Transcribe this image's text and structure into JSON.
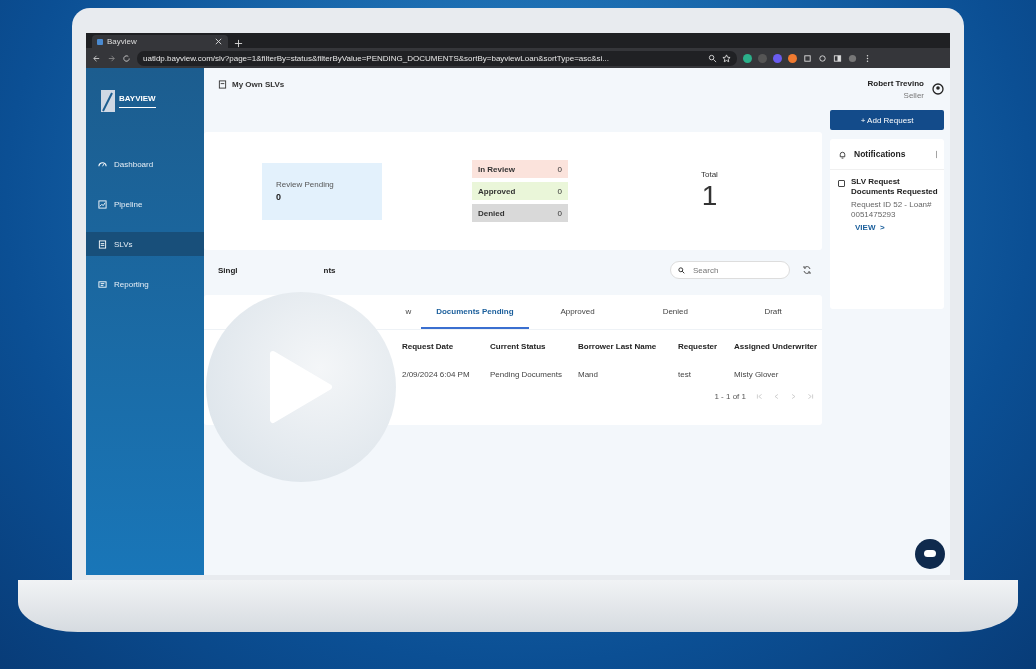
{
  "browser": {
    "tab_title": "Bayview",
    "address": "uatldp.bayview.com/slv?page=1&filterBy=status&filterByValue=PENDING_DOCUMENTS&sortBy=bayviewLoan&sortType=asc&si..."
  },
  "sidebar": {
    "logo": "BAYVIEW",
    "items": [
      {
        "label": "Dashboard",
        "selected": false
      },
      {
        "label": "Pipeline",
        "selected": false
      },
      {
        "label": "SLVs",
        "selected": true
      },
      {
        "label": "Reporting",
        "selected": false
      }
    ]
  },
  "header": {
    "title": "My Own SLVs",
    "user_name": "Robert Trevino",
    "user_role": "Seller"
  },
  "stats": {
    "review_pending_label": "Review Pending",
    "review_pending_value": "0",
    "statuses": [
      {
        "label": "In Review",
        "count": "0",
        "color": "#fbe3dc"
      },
      {
        "label": "Approved",
        "count": "0",
        "color": "#eaf6d9"
      },
      {
        "label": "Denied",
        "count": "0",
        "color": "#d9d9d9"
      }
    ],
    "total_label": "Total",
    "total_value": "1"
  },
  "section": {
    "title_start": "Singl",
    "title_end": "nts",
    "search_placeholder": "Search"
  },
  "tabs": [
    {
      "label": "w",
      "selected": false
    },
    {
      "label": "Documents Pending",
      "selected": true
    },
    {
      "label": "Approved",
      "selected": false
    },
    {
      "label": "Denied",
      "selected": false
    },
    {
      "label": "Draft",
      "selected": false
    }
  ],
  "table": {
    "columns": [
      "Request Date",
      "Current Status",
      "Borrower Last Name",
      "Requester",
      "Assigned Underwriter"
    ],
    "rows": [
      [
        "2/09/2024 6:04 PM",
        "Pending Documents",
        "Mand",
        "test",
        "Misty Glover"
      ]
    ],
    "pagination": "1 - 1 of 1"
  },
  "add_button": "+ Add Request",
  "notifications": {
    "title": "Notifications",
    "items": [
      {
        "title": "SLV Request Documents Requested",
        "detail": "Request ID 52 - Loan# 0051475293",
        "link": "VIEW",
        "arrow": ">",
        "checked": false
      }
    ]
  }
}
